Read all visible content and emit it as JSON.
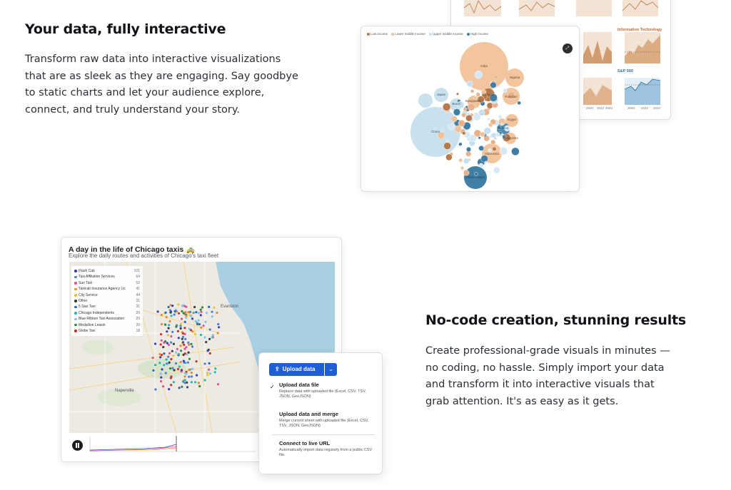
{
  "section1": {
    "heading": "Your data, fully interactive",
    "body": "Transform raw data into interactive visualizations that are as sleek as they are engaging. Say goodbye to static charts and let your audience explore, connect, and truly understand your story."
  },
  "section2": {
    "heading": "No-code creation, stunning results",
    "body": "Create professional-grade visuals in minutes — no coding, no hassle. Simply import your data and transform it into interactive visuals that grab attention. It's as easy as it gets."
  },
  "small_multiples": {
    "panel_titles": [
      "Information Technology",
      "S&P 500"
    ],
    "x_ticks": [
      "2020",
      "2022",
      "2024"
    ],
    "colors": {
      "orange": "#d9a57a",
      "blue": "#9ec3de"
    }
  },
  "bubble_chart": {
    "legend": [
      "Low income",
      "Lower middle income",
      "Upper middle income",
      "High income"
    ],
    "legend_colors": [
      "#b87a4b",
      "#f0c29c",
      "#c7e0ef",
      "#3f7fa6"
    ],
    "labels": [
      "India",
      "China",
      "Nigeria",
      "Pakistan",
      "Indonesia",
      "Brazil",
      "Japan",
      "Bangladesh",
      "Ethiopia",
      "Egypt",
      "Philippines",
      "Mexico",
      "United States"
    ],
    "expand_icon": "expand-icon"
  },
  "map": {
    "title": "A day in the life of Chicago taxis 🚕",
    "subtitle": "Explore the daily routes and activities of Chicago's taxi fleet",
    "legend": [
      {
        "name": "Flash Cab",
        "count": "101",
        "color": "#3a3fb0"
      },
      {
        "name": "Taxi Affiliation Services",
        "count": "64",
        "color": "#4f7dd6"
      },
      {
        "name": "Sun Taxi",
        "count": "52",
        "color": "#e0529b"
      },
      {
        "name": "Taxicab Insurance Agency Llc",
        "count": "41",
        "color": "#e58b2c"
      },
      {
        "name": "City Service",
        "count": "44",
        "color": "#e7c52e"
      },
      {
        "name": "Other",
        "count": "31",
        "color": "#3d3d3d"
      },
      {
        "name": "5 Star Taxi",
        "count": "31",
        "color": "#1f67c9"
      },
      {
        "name": "Chicago Independents",
        "count": "20",
        "color": "#26b5b0"
      },
      {
        "name": "Blue Ribbon Taxi Association",
        "count": "20",
        "color": "#7fc4e8"
      },
      {
        "name": "Medallion Leasin",
        "count": "20",
        "color": "#2e8a3a"
      },
      {
        "name": "Globe Taxi",
        "count": "18",
        "color": "#c7332b"
      }
    ],
    "places": [
      "Evanston",
      "Naperville",
      "Chicago"
    ],
    "play_icon": "pause-icon"
  },
  "upload_menu": {
    "button_label": "Upload data",
    "options": [
      {
        "title": "Upload data file",
        "desc": "Replace data with uploaded file (Excel, CSV, TSV, JSON, GeoJSON)",
        "checked": true
      },
      {
        "title": "Upload data and merge",
        "desc": "Merge current sheet with uploaded file (Excel, CSV, TSV, JSON, GeoJSON)",
        "checked": false
      },
      {
        "title": "Connect to live URL",
        "desc": "Automatically import data regularly from a public CSV file.",
        "checked": false
      }
    ]
  }
}
